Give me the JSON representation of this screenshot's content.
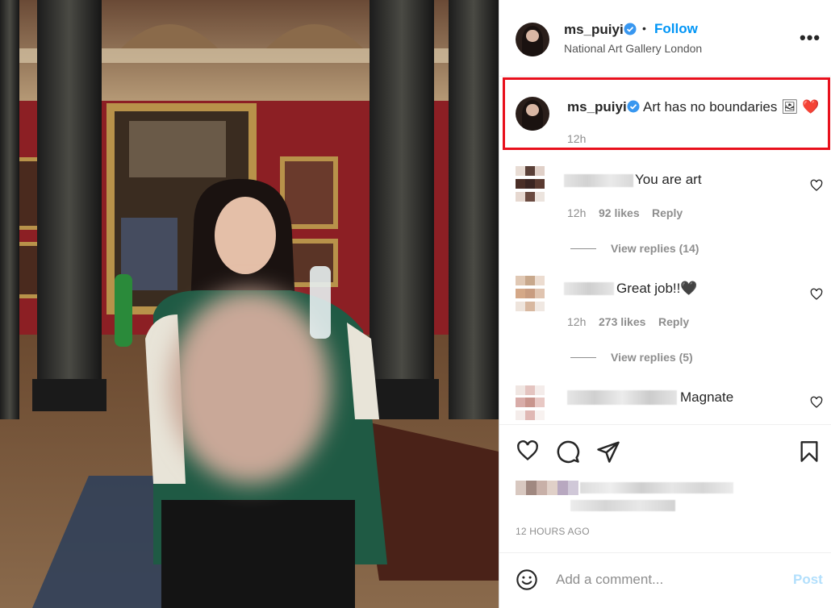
{
  "post": {
    "username": "ms_puiyi",
    "follow_label": "Follow",
    "dot": "•",
    "location": "National Art Gallery London",
    "more": "•••"
  },
  "caption": {
    "username": "ms_puiyi",
    "text": "Art has no boundaries 🖼 ❤️",
    "time": "12h"
  },
  "comments": [
    {
      "text": "You are art",
      "time": "12h",
      "likes": "92 likes",
      "reply": "Reply",
      "view_replies": "View replies (14)"
    },
    {
      "text": "Great job!!🖤",
      "time": "12h",
      "likes": "273 likes",
      "reply": "Reply",
      "view_replies": "View replies (5)"
    },
    {
      "text": "Magnate"
    }
  ],
  "footer": {
    "time_ago": "12 HOURS AGO",
    "add_comment_placeholder": "Add a comment...",
    "post_label": "Post"
  },
  "icons": {
    "like": "heart-icon",
    "comment": "comment-icon",
    "share": "share-icon",
    "save": "bookmark-icon",
    "emoji": "emoji-icon",
    "verified": "verified-badge-icon"
  },
  "colors": {
    "follow": "#0095f6",
    "highlight_border": "#e8101c",
    "verified": "#3897f0",
    "post_disabled": "#b2dffc"
  }
}
